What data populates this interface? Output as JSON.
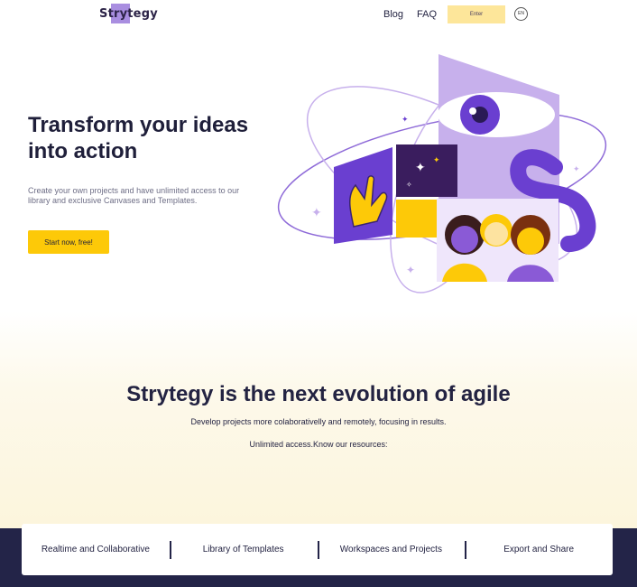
{
  "header": {
    "logo": "Strytegy",
    "nav": {
      "blog": "Blog",
      "faq": "FAQ"
    },
    "enter_label": "Enter",
    "language": "EN"
  },
  "hero": {
    "title": "Transform your ideas into action",
    "description": "Create your own projects and have unlimited access to our library and exclusive Canvases and Templates.",
    "cta": "Start now, free!"
  },
  "evolution": {
    "title": "Strytegy is the next evolution of agile",
    "subtitle": "Develop projects more colaborativelly and remotely, focusing in results.",
    "resources": "Unlimited access.Know our resources:"
  },
  "features": [
    {
      "label": "Realtime and Collaborative"
    },
    {
      "label": "Library of Templates"
    },
    {
      "label": "Workspaces and Projects"
    },
    {
      "label": "Export and Share"
    }
  ],
  "colors": {
    "accent_yellow": "#fdc908",
    "light_yellow": "#fde69a",
    "purple": "#6a3fd0",
    "lavender": "#c7b0ec",
    "navy": "#232448"
  }
}
